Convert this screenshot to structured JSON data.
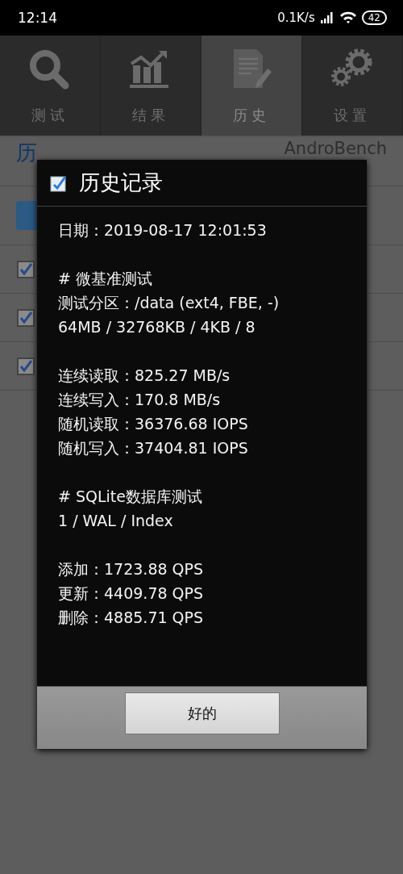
{
  "status_bar": {
    "time": "12:14",
    "speed": "0.1K/s",
    "battery": "42"
  },
  "tabs": [
    {
      "label": "测试",
      "kind": "search",
      "selected": false
    },
    {
      "label": "结果",
      "kind": "chart",
      "selected": false
    },
    {
      "label": "历史",
      "kind": "document",
      "selected": true
    },
    {
      "label": "设置",
      "kind": "gears",
      "selected": false
    }
  ],
  "page": {
    "title": "历",
    "logo": "AndroBench",
    "rows": [
      {
        "checked": true
      },
      {
        "checked": true
      },
      {
        "checked": true
      }
    ]
  },
  "dialog": {
    "title": "历史记录",
    "sections": [
      [
        "日期：2019-08-17 12:01:53"
      ],
      [
        "# 微基准测试",
        "测试分区：/data (ext4, FBE, -)",
        "64MB / 32768KB / 4KB / 8"
      ],
      [
        "连续读取：825.27 MB/s",
        "连续写入：170.8 MB/s",
        "随机读取：36376.68 IOPS",
        "随机写入：37404.81 IOPS"
      ],
      [
        "# SQLite数据库测试",
        "1 / WAL / Index"
      ],
      [
        "添加：1723.88 QPS",
        "更新：4409.78 QPS",
        "删除：4885.71 QPS"
      ]
    ],
    "button": "好的"
  }
}
